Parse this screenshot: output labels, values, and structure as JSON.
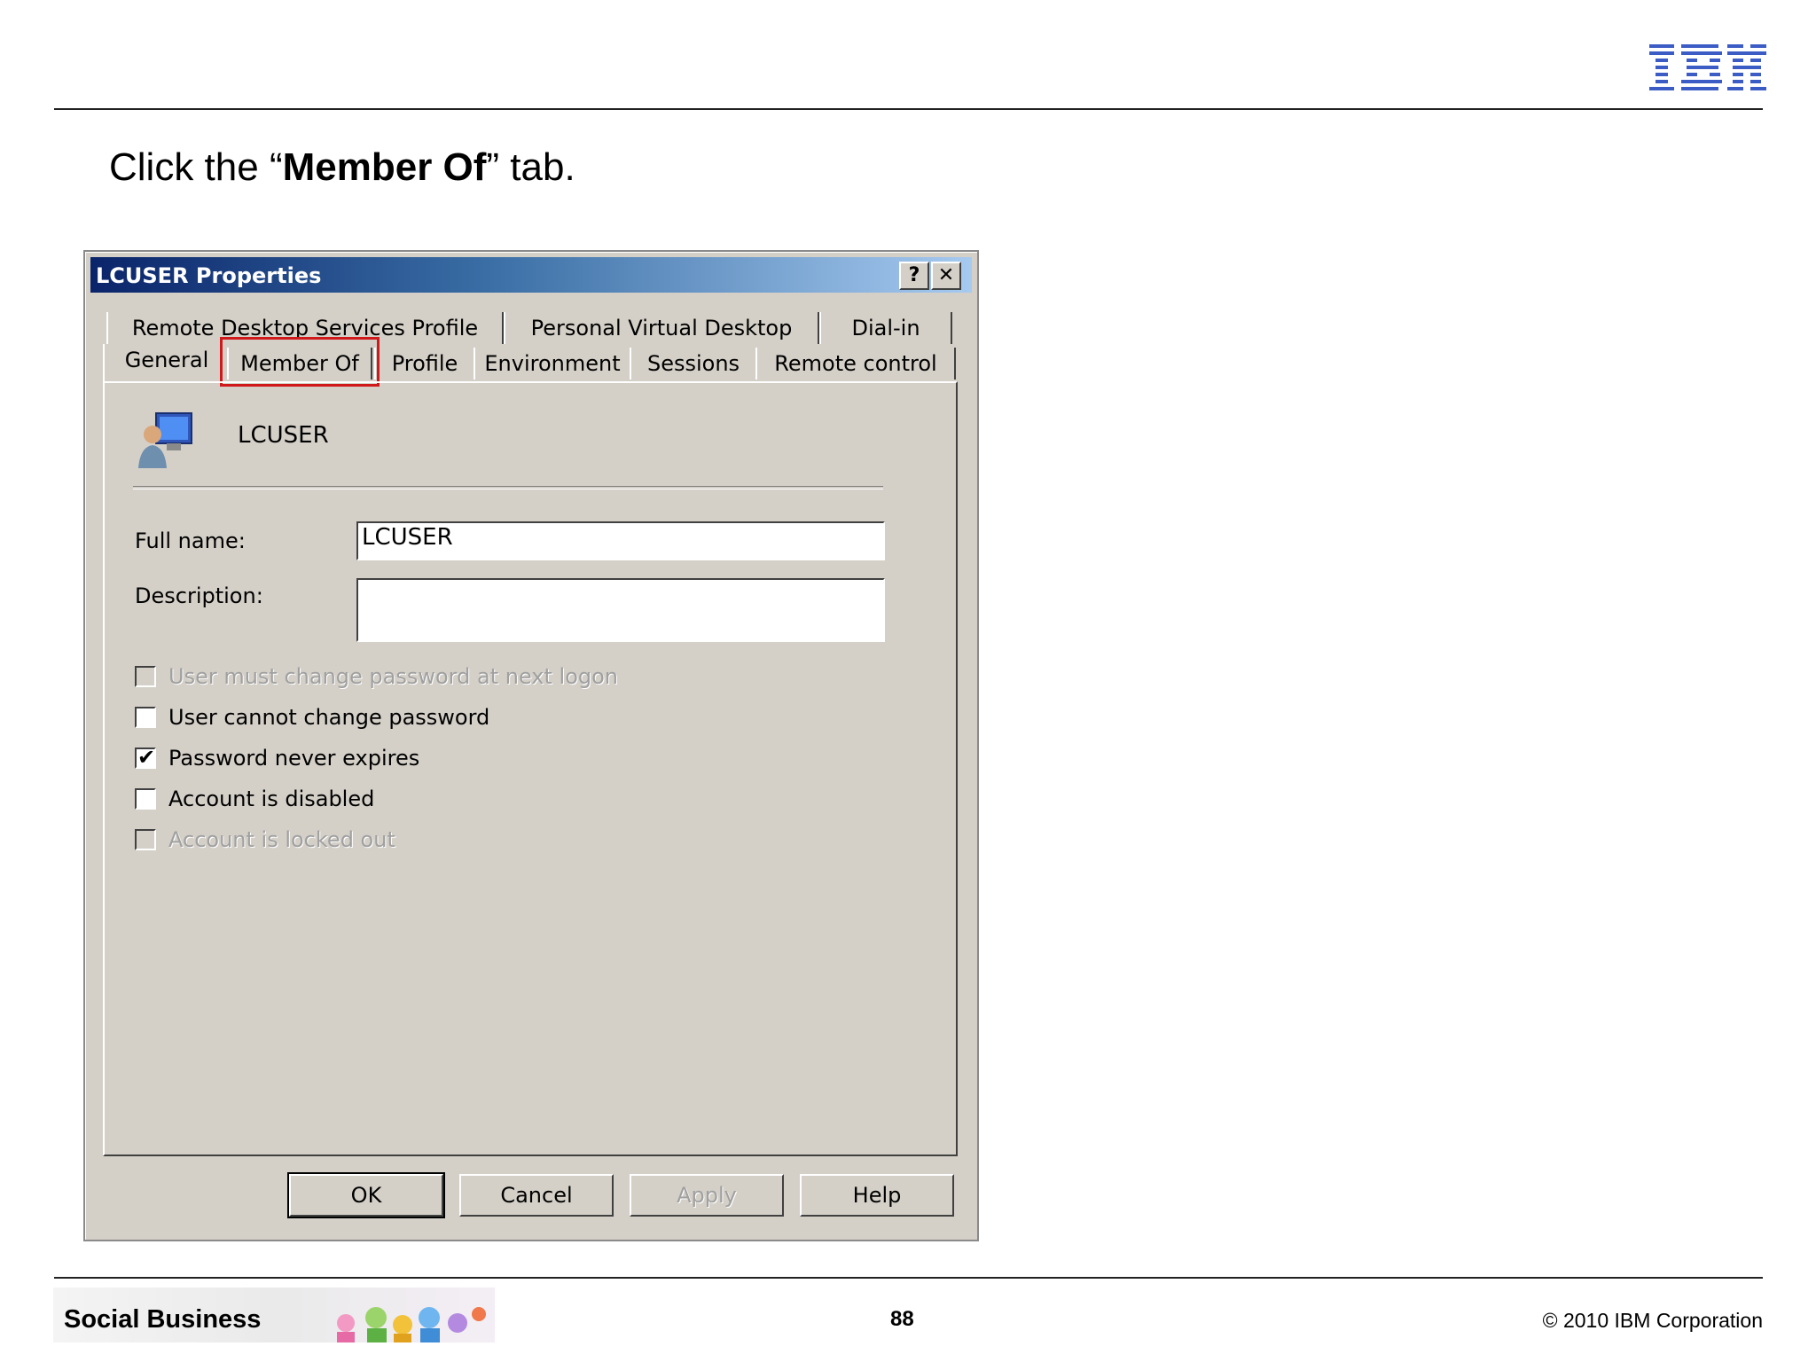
{
  "slide": {
    "logo_text": "IBM",
    "instruction": {
      "prefix": "Click the “",
      "bold": "Member Of",
      "suffix": "” tab."
    },
    "footer": {
      "brand": "Social Business",
      "page": "88",
      "copyright": "© 2010 IBM Corporation"
    }
  },
  "dialog": {
    "title": "LCUSER Properties",
    "help_button": "?",
    "close_button": "✕",
    "tabs_row1": [
      "Remote Desktop Services Profile",
      "Personal Virtual Desktop",
      "Dial-in"
    ],
    "tabs_row2": [
      "General",
      "Member Of",
      "Profile",
      "Environment",
      "Sessions",
      "Remote control"
    ],
    "selected_tab": "General",
    "highlighted_tab": "Member Of",
    "user_name": "LCUSER",
    "fields": {
      "full_name_label": "Full name:",
      "full_name_value": "LCUSER",
      "description_label": "Description:",
      "description_value": ""
    },
    "checkboxes": [
      {
        "label": "User must change password at next logon",
        "checked": false,
        "disabled": true
      },
      {
        "label": "User cannot change password",
        "checked": false,
        "disabled": false
      },
      {
        "label": "Password never expires",
        "checked": true,
        "disabled": false
      },
      {
        "label": "Account is disabled",
        "checked": false,
        "disabled": false
      },
      {
        "label": "Account is locked out",
        "checked": false,
        "disabled": true
      }
    ],
    "buttons": {
      "ok": "OK",
      "cancel": "Cancel",
      "apply": "Apply",
      "help": "Help"
    },
    "colors": {
      "titlebar_start": "#0a246a",
      "dialog_bg": "#d4d0c8",
      "highlight": "#d0191b"
    }
  }
}
